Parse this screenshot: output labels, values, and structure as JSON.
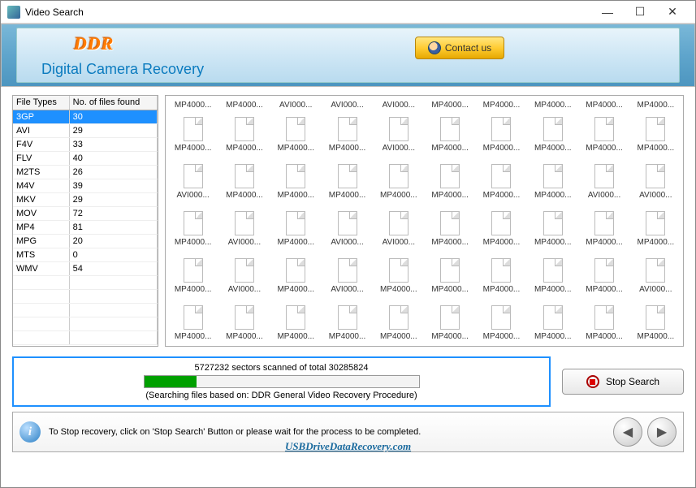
{
  "window": {
    "title": "Video Search"
  },
  "header": {
    "logo": "DDR",
    "product": "Digital Camera Recovery",
    "contact": "Contact us"
  },
  "table": {
    "headers": [
      "File Types",
      "No. of files found"
    ],
    "rows": [
      {
        "type": "3GP",
        "count": "30",
        "selected": true
      },
      {
        "type": "AVI",
        "count": "29"
      },
      {
        "type": "F4V",
        "count": "33"
      },
      {
        "type": "FLV",
        "count": "40"
      },
      {
        "type": "M2TS",
        "count": "26"
      },
      {
        "type": "M4V",
        "count": "39"
      },
      {
        "type": "MKV",
        "count": "29"
      },
      {
        "type": "MOV",
        "count": "72"
      },
      {
        "type": "MP4",
        "count": "81"
      },
      {
        "type": "MPG",
        "count": "20"
      },
      {
        "type": "MTS",
        "count": "0"
      },
      {
        "type": "WMV",
        "count": "54"
      }
    ]
  },
  "files": {
    "row0": [
      "MP4000...",
      "MP4000...",
      "AVI000...",
      "AVI000...",
      "AVI000...",
      "MP4000...",
      "MP4000...",
      "MP4000...",
      "MP4000...",
      "MP4000..."
    ],
    "grid": [
      [
        "MP4000...",
        "MP4000...",
        "MP4000...",
        "MP4000...",
        "AVI000...",
        "MP4000...",
        "MP4000...",
        "MP4000...",
        "MP4000...",
        "MP4000..."
      ],
      [
        "AVI000...",
        "MP4000...",
        "MP4000...",
        "MP4000...",
        "MP4000...",
        "MP4000...",
        "MP4000...",
        "MP4000...",
        "AVI000...",
        "AVI000..."
      ],
      [
        "MP4000...",
        "AVI000...",
        "MP4000...",
        "AVI000...",
        "AVI000...",
        "MP4000...",
        "MP4000...",
        "MP4000...",
        "MP4000...",
        "MP4000..."
      ],
      [
        "MP4000...",
        "AVI000...",
        "MP4000...",
        "AVI000...",
        "MP4000...",
        "MP4000...",
        "MP4000...",
        "MP4000...",
        "MP4000...",
        "AVI000..."
      ],
      [
        "MP4000...",
        "MP4000...",
        "MP4000...",
        "MP4000...",
        "MP4000...",
        "MP4000...",
        "MP4000...",
        "MP4000...",
        "MP4000...",
        "MP4000..."
      ]
    ]
  },
  "progress": {
    "scanned": 5727232,
    "total": 30285824,
    "text": "5727232 sectors scanned of total 30285824",
    "sub": "(Searching files based on:  DDR General Video Recovery Procedure)",
    "percent": 19
  },
  "buttons": {
    "stop": "Stop Search"
  },
  "footer": {
    "hint": "To Stop recovery, click on 'Stop Search' Button or please wait for the process to be completed.",
    "url": "USBDriveDataRecovery.com"
  }
}
